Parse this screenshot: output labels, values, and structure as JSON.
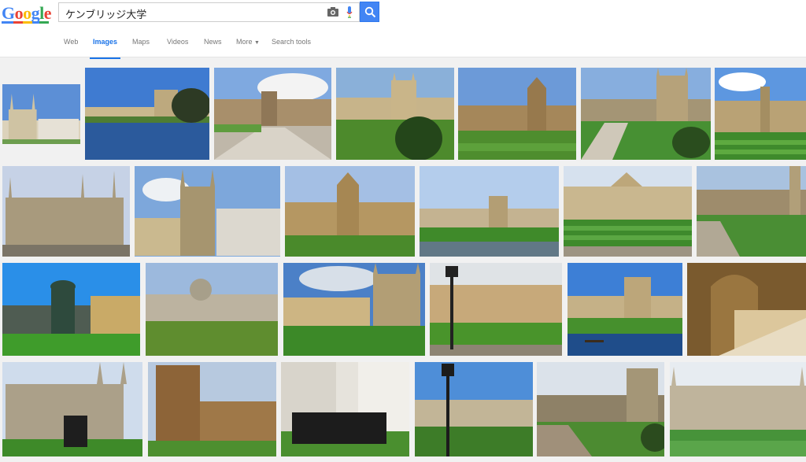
{
  "logo": {
    "text": "Google"
  },
  "search": {
    "query": "ケンブリッジ大学"
  },
  "tabs": [
    {
      "label": "Web",
      "active": false
    },
    {
      "label": "Images",
      "active": true
    },
    {
      "label": "Maps",
      "active": false
    },
    {
      "label": "Videos",
      "active": false
    },
    {
      "label": "News",
      "active": false
    },
    {
      "label": "More",
      "active": false
    },
    {
      "label": "Search tools",
      "active": false
    }
  ],
  "colors": {
    "accent": "#4285f4",
    "sky": "#6fa3e0",
    "grass": "#3e8c2e",
    "stone": "#b8a582"
  },
  "results": {
    "rows": [
      {
        "images": [
          {
            "scene": "kings-college-chapel"
          },
          {
            "scene": "riverside-reflection"
          },
          {
            "scene": "gatehouse-lawn"
          },
          {
            "scene": "aerial-chapel"
          },
          {
            "scene": "courtyard-gothic"
          },
          {
            "scene": "aerial-courtyard"
          },
          {
            "scene": "lawn-facade"
          }
        ]
      },
      {
        "images": [
          {
            "scene": "chapel-side"
          },
          {
            "scene": "chapel-corner"
          },
          {
            "scene": "gatehouse-dome"
          },
          {
            "scene": "lawn-wide"
          },
          {
            "scene": "courtyard-portico"
          },
          {
            "scene": "aerial-lawn"
          }
        ]
      },
      {
        "images": [
          {
            "scene": "fountain"
          },
          {
            "scene": "domed-gate"
          },
          {
            "scene": "chapel-lawn"
          },
          {
            "scene": "lamppost-court"
          },
          {
            "scene": "river-punt"
          },
          {
            "scene": "cloister-arcade"
          }
        ]
      },
      {
        "images": [
          {
            "scene": "chapel-plaque"
          },
          {
            "scene": "great-gate"
          },
          {
            "scene": "graduates"
          },
          {
            "scene": "lamppost-gate"
          },
          {
            "scene": "aerial-town"
          },
          {
            "scene": "chapel-front"
          }
        ]
      }
    ]
  }
}
